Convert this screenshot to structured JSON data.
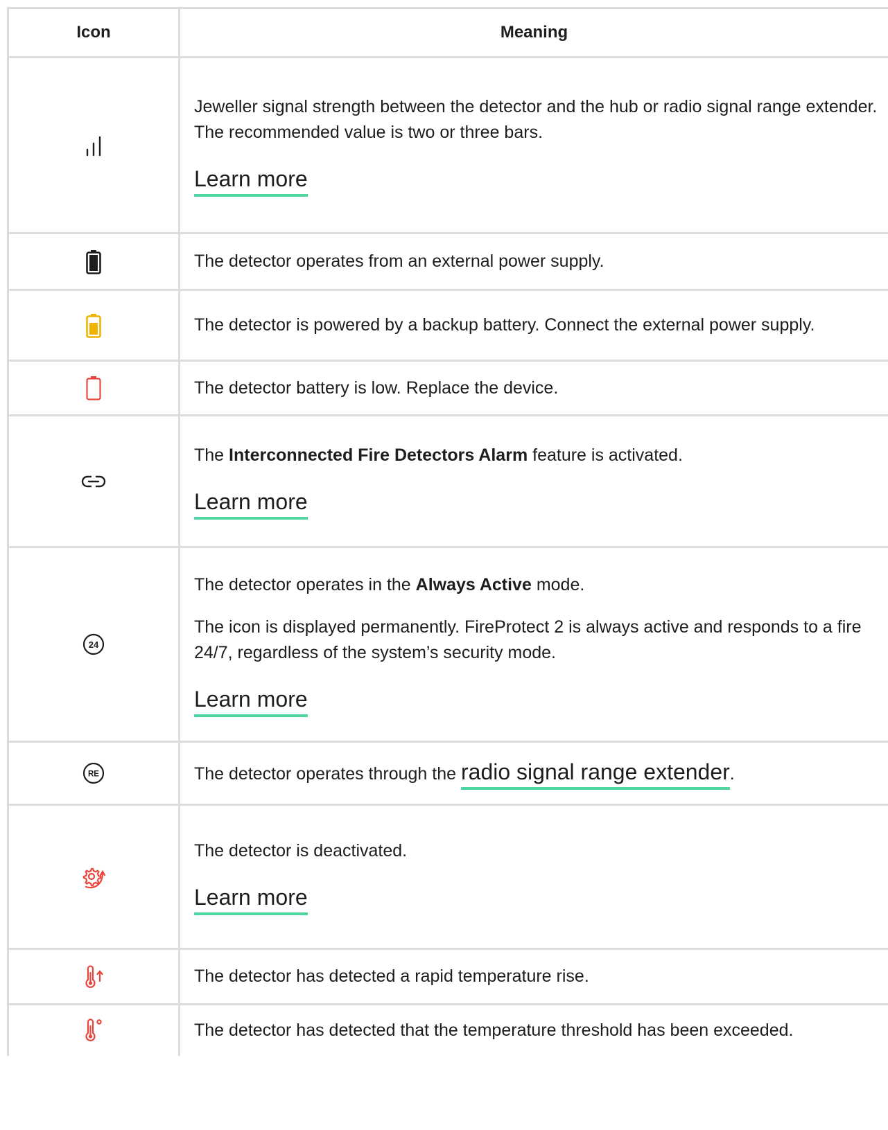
{
  "header": {
    "icon_label": "Icon",
    "meaning_label": "Meaning"
  },
  "colors": {
    "warning": "#f0b400",
    "danger": "#e8453c",
    "accent_underline": "#4fd6a0",
    "border": "#dcdcdc"
  },
  "rows": [
    {
      "icon": "signal-strength-icon",
      "text": "Jeweller signal strength between the detector and the hub or radio signal range extender. The recommended value is two or three bars.",
      "link": "Learn more"
    },
    {
      "icon": "battery-full-icon",
      "text": "The detector operates from an external power supply."
    },
    {
      "icon": "battery-backup-icon",
      "text": "The detector is powered by a backup battery. Connect the external power supply."
    },
    {
      "icon": "battery-low-icon",
      "text": "The detector battery is low. Replace the device."
    },
    {
      "icon": "interconnect-link-icon",
      "text_before": "The ",
      "bold": "Interconnected Fire Detectors Alarm",
      "text_after": " feature is activated.",
      "link": "Learn more"
    },
    {
      "icon": "always-active-24-icon",
      "text_before": "The detector operates in the ",
      "bold": "Always Active",
      "text_after": " mode.",
      "text2": "The icon is displayed permanently. FireProtect 2 is always active and responds to a fire 24/7, regardless of the system’s security mode.",
      "link": "Learn more"
    },
    {
      "icon": "range-extender-icon",
      "text_before": "The detector operates through the ",
      "link": "radio signal range extender",
      "text_after": "."
    },
    {
      "icon": "deactivated-gear-icon",
      "text": "The detector is deactivated.",
      "link": "Learn more"
    },
    {
      "icon": "temperature-rise-icon",
      "text": "The detector has detected a rapid temperature rise."
    },
    {
      "icon": "temperature-threshold-icon",
      "text": "The detector has detected that the temperature threshold has been exceeded."
    }
  ]
}
